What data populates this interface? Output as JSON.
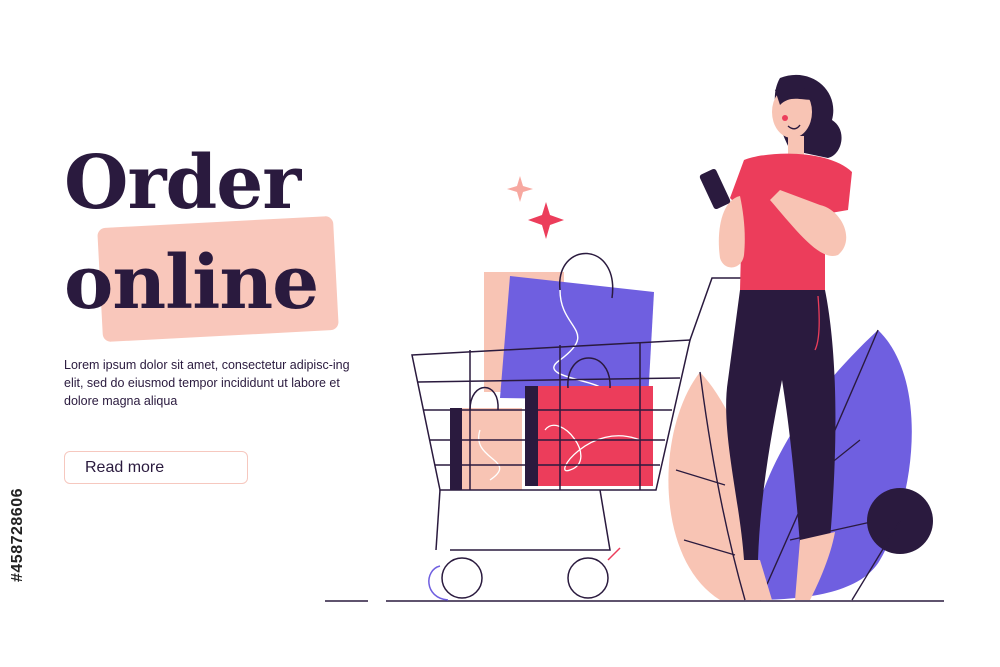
{
  "hero": {
    "title_line1": "Order",
    "title_line2": "online",
    "body": "Lorem ipsum dolor sit amet, consectetur adipisc-ing elit, sed do eiusmod tempor incididunt ut labore et dolore magna aliqua",
    "button_label": "Read more"
  },
  "watermark": {
    "stock_id": "#458728606"
  },
  "illustration": {
    "icons": [
      "sparkle-icon",
      "shopping-cart-icon",
      "shopping-bag-icon",
      "leaf-icon",
      "smartphone-icon"
    ]
  },
  "colors": {
    "headline": "#2a1a3e",
    "highlight": "#f9c7bb",
    "accent_red": "#ec3d5b",
    "accent_purple": "#6f5fe0",
    "peach": "#f8c4b4"
  }
}
